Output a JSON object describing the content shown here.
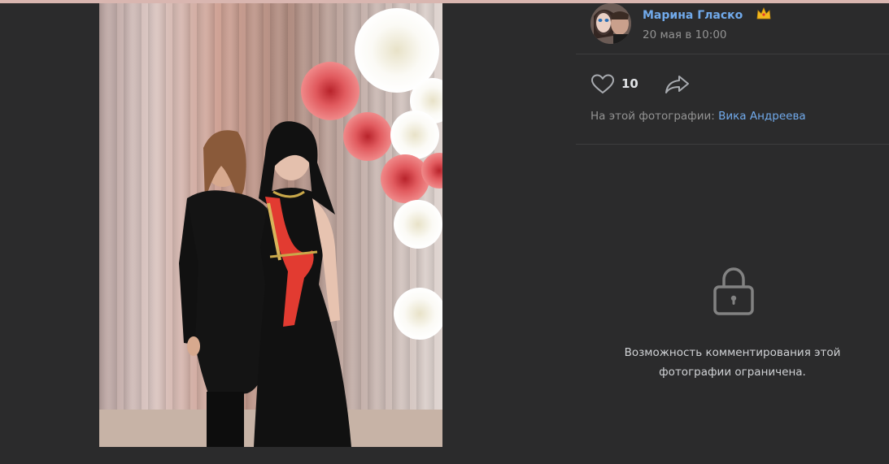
{
  "post": {
    "author_name": "Марина Гласко",
    "date": "20 мая в 10:00",
    "author_badge_icon": "crown-icon"
  },
  "actions": {
    "likes_count": "10",
    "like_icon": "heart-icon",
    "share_icon": "share-arrow-icon"
  },
  "tags": {
    "prefix": "На этой фотографии:",
    "person": "Вика Андреева"
  },
  "comments": {
    "lock_icon": "lock-icon",
    "restricted_line1": "Возможность комментирования этой",
    "restricted_line2": "фотографии ограничена."
  },
  "colors": {
    "background": "#2b2b2c",
    "link": "#71aaeb",
    "muted_text": "#939393",
    "divider": "#3d3d3e"
  }
}
